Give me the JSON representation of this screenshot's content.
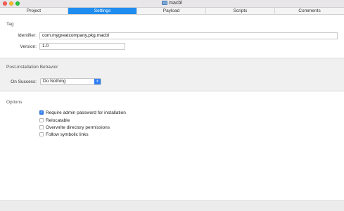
{
  "window": {
    "title": "macbl"
  },
  "tabs": [
    {
      "label": "Project"
    },
    {
      "label": "Settings",
      "active": true
    },
    {
      "label": "Payload"
    },
    {
      "label": "Scripts"
    },
    {
      "label": "Comments"
    }
  ],
  "tag": {
    "section_title": "Tag",
    "identifier_label": "Identifier:",
    "identifier_value": "com.mygreatcompany.pkg.macbl",
    "version_label": "Version:",
    "version_value": "1.0"
  },
  "post_install": {
    "section_title": "Post-installation Behavior",
    "on_success_label": "On Success:",
    "on_success_value": "Do Nothing"
  },
  "options": {
    "section_title": "Options",
    "items": [
      {
        "label": "Require admin password for installation",
        "checked": true
      },
      {
        "label": "Relocatable",
        "checked": false
      },
      {
        "label": "Overwrite directory permissions",
        "checked": false
      },
      {
        "label": "Follow symbolic links",
        "checked": false
      }
    ]
  },
  "colors": {
    "accent": "#1f8cf0",
    "checkbox_checked": "#2f7ef7"
  }
}
